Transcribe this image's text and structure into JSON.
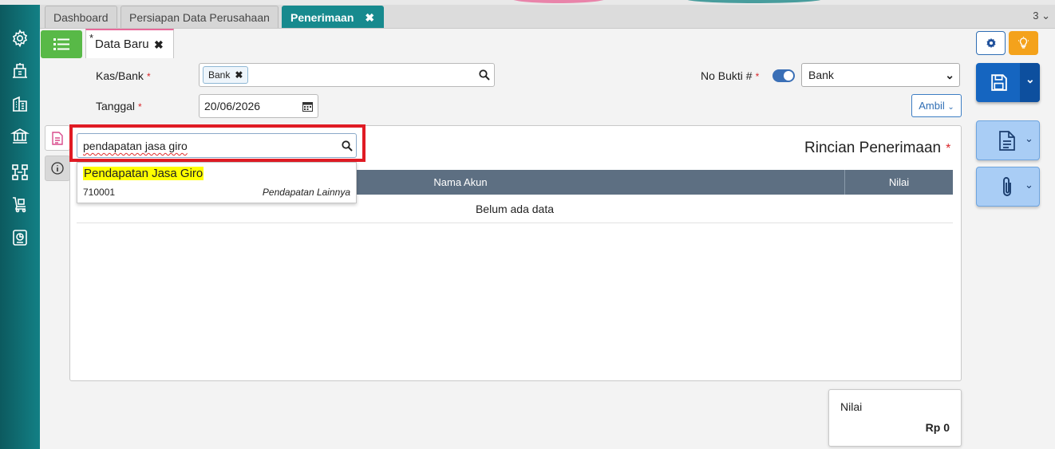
{
  "tabs": [
    {
      "label": "Dashboard"
    },
    {
      "label": "Persiapan Data Perusahaan"
    },
    {
      "label": "Penerimaan"
    }
  ],
  "tab_close_glyph": "✖",
  "tab_count": "3",
  "doc_tab": {
    "modified_mark": "*",
    "label": "Data Baru",
    "close": "✖"
  },
  "form": {
    "kas_bank_label": "Kas/Bank",
    "kas_bank_chip": "Bank",
    "tanggal_label": "Tanggal",
    "tanggal_value": "20/06/2026",
    "no_bukti_label": "No Bukti #",
    "no_bukti_select": "Bank",
    "required_mark": "*",
    "ambil_label": "Ambil"
  },
  "detail": {
    "title": "Rincian Penerimaan",
    "search_value": "pendapatan jasa giro",
    "dropdown": {
      "name": "Pendapatan Jasa Giro",
      "code": "710001",
      "category": "Pendapatan Lainnya"
    },
    "columns": [
      "Nama Akun",
      "Nilai"
    ],
    "empty_text": "Belum ada data"
  },
  "summary": {
    "label": "Nilai",
    "value": "Rp 0"
  },
  "colors": {
    "sidebar": "#0f6d72",
    "active_tab": "#178a8e",
    "green_button": "#58b947",
    "save_button": "#1565c0",
    "light_blue_button": "#a9cdf5",
    "orange_button": "#f4a21b",
    "highlight": "#e01b24",
    "table_header": "#5d6f82"
  },
  "icons": {
    "sidebar": [
      "gear-icon",
      "building-icon",
      "office-icon",
      "bank-icon",
      "hierarchy-icon",
      "cart-icon",
      "report-icon"
    ]
  }
}
